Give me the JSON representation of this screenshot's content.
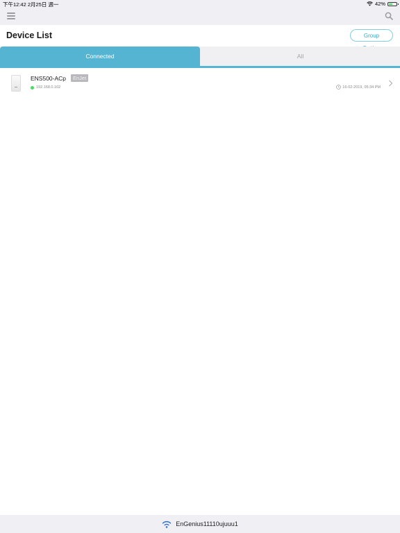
{
  "status_bar": {
    "time_date": "下午12:42   2月25日 週一",
    "battery": "42%",
    "battery_level": 0.42
  },
  "header": {
    "title": "Device List",
    "group_setting_label": "Group Setting"
  },
  "tabs": [
    {
      "label": "Connected",
      "active": true
    },
    {
      "label": "All",
      "active": false
    }
  ],
  "devices": [
    {
      "name": "ENS500-ACp",
      "badge": "EnJet",
      "ip": "192.168.0.102",
      "status": "online",
      "timestamp": "16-02-2019, 05:34 PM"
    }
  ],
  "footer": {
    "ssid": "EnGenius11110ujuuu1"
  },
  "icons": {
    "menu": "hamburger-icon",
    "search": "search-icon",
    "wifi": "wifi-icon",
    "clock": "clock-icon",
    "chevron": "chevron-right-icon"
  },
  "colors": {
    "accent": "#56b4d3",
    "online": "#4cd964",
    "group_button": "#3aa8c5"
  }
}
